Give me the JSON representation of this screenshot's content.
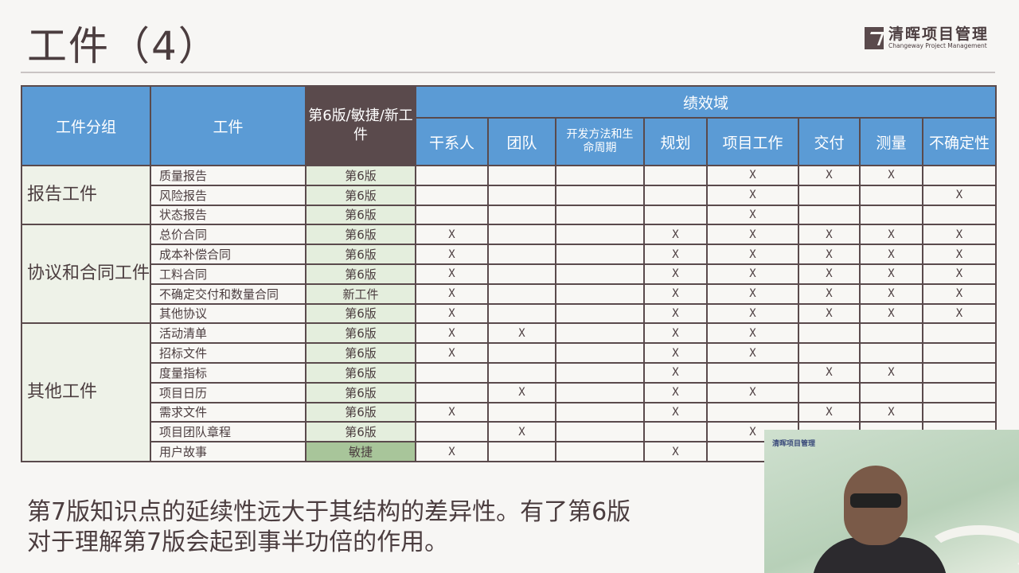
{
  "title": "工件（4）",
  "logo": {
    "cn": "清晖项目管理",
    "en": "Changeway Project Management"
  },
  "table": {
    "headers": {
      "group": "工件分组",
      "artifact": "工件",
      "version": "第6版/敏捷/新工件",
      "domain": "绩效域"
    },
    "domains": [
      "干系人",
      "团队",
      "开发方法和生命周期",
      "规划",
      "项目工作",
      "交付",
      "测量",
      "不确定性"
    ],
    "groups": [
      {
        "name": "报告工件",
        "rows": [
          {
            "artifact": "质量报告",
            "version": "第6版",
            "marks": [
              "",
              "",
              "",
              "",
              "X",
              "X",
              "X",
              ""
            ]
          },
          {
            "artifact": "风险报告",
            "version": "第6版",
            "marks": [
              "",
              "",
              "",
              "",
              "X",
              "",
              "",
              "X"
            ]
          },
          {
            "artifact": "状态报告",
            "version": "第6版",
            "marks": [
              "",
              "",
              "",
              "",
              "X",
              "",
              "",
              ""
            ]
          }
        ]
      },
      {
        "name": "协议和合同工件",
        "rows": [
          {
            "artifact": "总价合同",
            "version": "第6版",
            "marks": [
              "X",
              "",
              "",
              "X",
              "X",
              "X",
              "X",
              "X"
            ]
          },
          {
            "artifact": "成本补偿合同",
            "version": "第6版",
            "marks": [
              "X",
              "",
              "",
              "X",
              "X",
              "X",
              "X",
              "X"
            ]
          },
          {
            "artifact": "工料合同",
            "version": "第6版",
            "marks": [
              "X",
              "",
              "",
              "X",
              "X",
              "X",
              "X",
              "X"
            ]
          },
          {
            "artifact": "不确定交付和数量合同",
            "version": "新工件",
            "marks": [
              "X",
              "",
              "",
              "X",
              "X",
              "X",
              "X",
              "X"
            ]
          },
          {
            "artifact": "其他协议",
            "version": "第6版",
            "marks": [
              "X",
              "",
              "",
              "X",
              "X",
              "X",
              "X",
              "X"
            ]
          }
        ]
      },
      {
        "name": "其他工件",
        "rows": [
          {
            "artifact": "活动清单",
            "version": "第6版",
            "marks": [
              "X",
              "X",
              "",
              "X",
              "X",
              "",
              "",
              ""
            ]
          },
          {
            "artifact": "招标文件",
            "version": "第6版",
            "marks": [
              "X",
              "",
              "",
              "X",
              "X",
              "",
              "",
              ""
            ]
          },
          {
            "artifact": "度量指标",
            "version": "第6版",
            "marks": [
              "",
              "",
              "",
              "X",
              "",
              "X",
              "X",
              ""
            ]
          },
          {
            "artifact": "项目日历",
            "version": "第6版",
            "marks": [
              "",
              "X",
              "",
              "X",
              "X",
              "",
              "",
              ""
            ]
          },
          {
            "artifact": "需求文件",
            "version": "第6版",
            "marks": [
              "X",
              "",
              "",
              "X",
              "",
              "X",
              "X",
              ""
            ]
          },
          {
            "artifact": "项目团队章程",
            "version": "第6版",
            "marks": [
              "",
              "X",
              "",
              "",
              "X",
              "",
              "",
              ""
            ]
          },
          {
            "artifact": "用户故事",
            "version": "敏捷",
            "marks": [
              "X",
              "",
              "",
              "X",
              "",
              "",
              "",
              ""
            ]
          }
        ]
      }
    ]
  },
  "note": [
    "第7版知识点的延续性远大于其结构的差异性。有了第6版",
    "对于理解第7版会起到事半功倍的作用。"
  ],
  "video": {
    "logo": "清晖项目管理"
  }
}
